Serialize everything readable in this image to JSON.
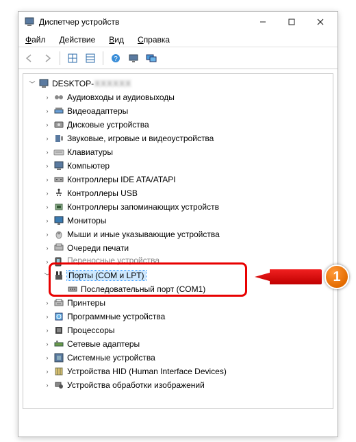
{
  "window": {
    "title": "Диспетчер устройств",
    "controls": {
      "min": "—",
      "max": "☐",
      "close": "✕"
    }
  },
  "menu": {
    "file": "Файл",
    "action": "Действие",
    "view": "Вид",
    "help": "Справка"
  },
  "tree": {
    "root": "DESKTOP-",
    "root_blur": "XXXXXX",
    "items": [
      {
        "label": "Аудиовходы и аудиовыходы"
      },
      {
        "label": "Видеоадаптеры"
      },
      {
        "label": "Дисковые устройства"
      },
      {
        "label": "Звуковые, игровые и видеоустройства"
      },
      {
        "label": "Клавиатуры"
      },
      {
        "label": "Компьютер"
      },
      {
        "label": "Контроллеры IDE ATA/ATAPI"
      },
      {
        "label": "Контроллеры USB"
      },
      {
        "label": "Контроллеры запоминающих устройств"
      },
      {
        "label": "Мониторы"
      },
      {
        "label": "Мыши и иные указывающие устройства"
      },
      {
        "label": "Очереди печати"
      },
      {
        "label": "Переносные устройства",
        "clipped": true
      },
      {
        "label": "Порты (COM и LPT)",
        "expanded": true,
        "selected": true,
        "children": [
          {
            "label": "Последовательный порт (COM1)"
          }
        ]
      },
      {
        "label": "Принтеры"
      },
      {
        "label": "Программные устройства"
      },
      {
        "label": "Процессоры"
      },
      {
        "label": "Сетевые адаптеры"
      },
      {
        "label": "Системные устройства"
      },
      {
        "label": "Устройства HID (Human Interface Devices)"
      },
      {
        "label": "Устройства обработки изображений"
      }
    ]
  },
  "callout": {
    "number": "1"
  },
  "icons": {
    "app": "computer-icon",
    "toolbar": [
      "back",
      "forward",
      "|",
      "grid",
      "list",
      "|",
      "help",
      "monitor",
      "display"
    ]
  }
}
